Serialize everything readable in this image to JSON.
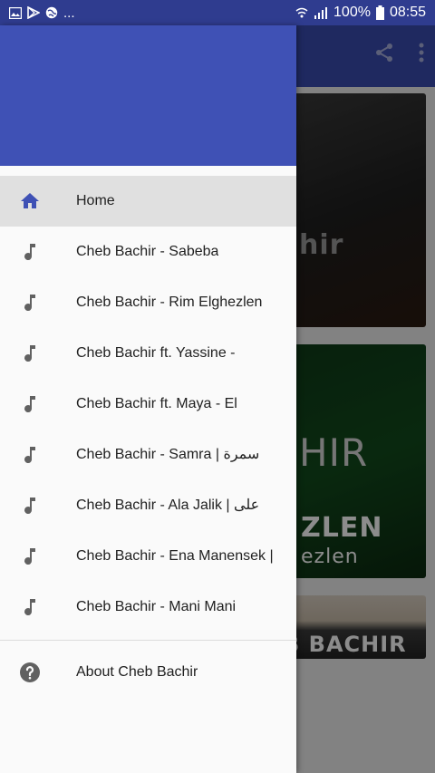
{
  "status_bar": {
    "left_icons": [
      "image-icon",
      "play-store-icon",
      "globe-icon"
    ],
    "left_more": "...",
    "battery": "100%",
    "time": "08:55"
  },
  "app_bar": {
    "icons": [
      "share-icon",
      "more-vert-icon"
    ]
  },
  "background_cards": {
    "card1_text": "hir",
    "card2_text_top": "HIR",
    "card2_text_mid": "ZLEN",
    "card2_text_bottom": "ezlen",
    "card3_text": "B BACHIR"
  },
  "drawer": {
    "items": [
      {
        "label": "Home",
        "icon": "home-icon",
        "active": true
      },
      {
        "label": "Cheb Bachir - Sabeba",
        "icon": "music-note-icon",
        "active": false
      },
      {
        "label": "Cheb Bachir - Rim Elghezlen",
        "icon": "music-note-icon",
        "active": false
      },
      {
        "label": "Cheb Bachir ft. Yassine -",
        "icon": "music-note-icon",
        "active": false
      },
      {
        "label": "Cheb Bachir ft. Maya - El",
        "icon": "music-note-icon",
        "active": false
      },
      {
        "label": "Cheb Bachir - Samra | سمرة",
        "icon": "music-note-icon",
        "active": false
      },
      {
        "label": "Cheb Bachir - Ala Jalik | على",
        "icon": "music-note-icon",
        "active": false
      },
      {
        "label": "Cheb Bachir - Ena Manensek |",
        "icon": "music-note-icon",
        "active": false
      },
      {
        "label": "Cheb Bachir - Mani Mani",
        "icon": "music-note-icon",
        "active": false
      }
    ],
    "about": {
      "label": "About Cheb Bachir",
      "icon": "help-circle-icon"
    }
  },
  "colors": {
    "primary": "#3f51b5",
    "status_bar": "#2f3c8f",
    "active_icon": "#3f51b5",
    "icon_gray": "#616161",
    "active_row": "#e0e0e0"
  }
}
